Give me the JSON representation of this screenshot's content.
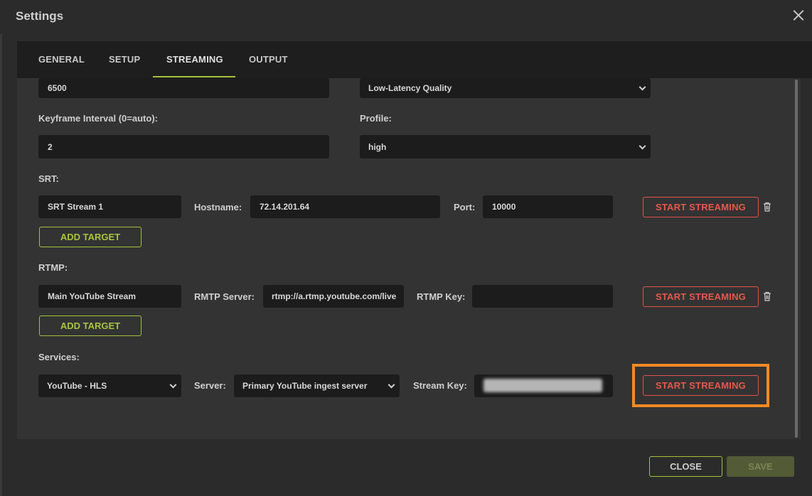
{
  "dialog": {
    "title": "Settings"
  },
  "tabs": [
    {
      "label": "GENERAL"
    },
    {
      "label": "SETUP"
    },
    {
      "label": "STREAMING",
      "active": true
    },
    {
      "label": "OUTPUT"
    }
  ],
  "encoding": {
    "bitrate_value": "6500",
    "preset_value": "Low-Latency Quality",
    "keyframe_label": "Keyframe Interval (0=auto):",
    "keyframe_value": "2",
    "profile_label": "Profile:",
    "profile_value": "high"
  },
  "srt": {
    "section_label": "SRT:",
    "target_name": "SRT Stream 1",
    "hostname_label": "Hostname:",
    "hostname_value": "72.14.201.64",
    "port_label": "Port:",
    "port_value": "10000",
    "start_label": "START STREAMING",
    "add_target_label": "ADD TARGET"
  },
  "rtmp": {
    "section_label": "RTMP:",
    "target_name": "Main YouTube Stream",
    "server_label": "RMTP Server:",
    "server_value": "rtmp://a.rtmp.youtube.com/live",
    "key_label": "RTMP Key:",
    "key_value": "",
    "start_label": "START STREAMING",
    "add_target_label": "ADD TARGET"
  },
  "services": {
    "section_label": "Services:",
    "service_value": "YouTube - HLS",
    "server_label": "Server:",
    "server_value": "Primary YouTube ingest server",
    "stream_key_label": "Stream Key:",
    "start_label": "START STREAMING"
  },
  "footer": {
    "close_label": "CLOSE",
    "save_label": "SAVE"
  },
  "colors": {
    "accent_green": "#a4c13a",
    "danger_red": "#e0534a",
    "highlight_orange": "#f28a24"
  },
  "icons": {
    "close": "close-icon",
    "trash": "trash-icon",
    "chevron": "chevron-down-icon"
  }
}
